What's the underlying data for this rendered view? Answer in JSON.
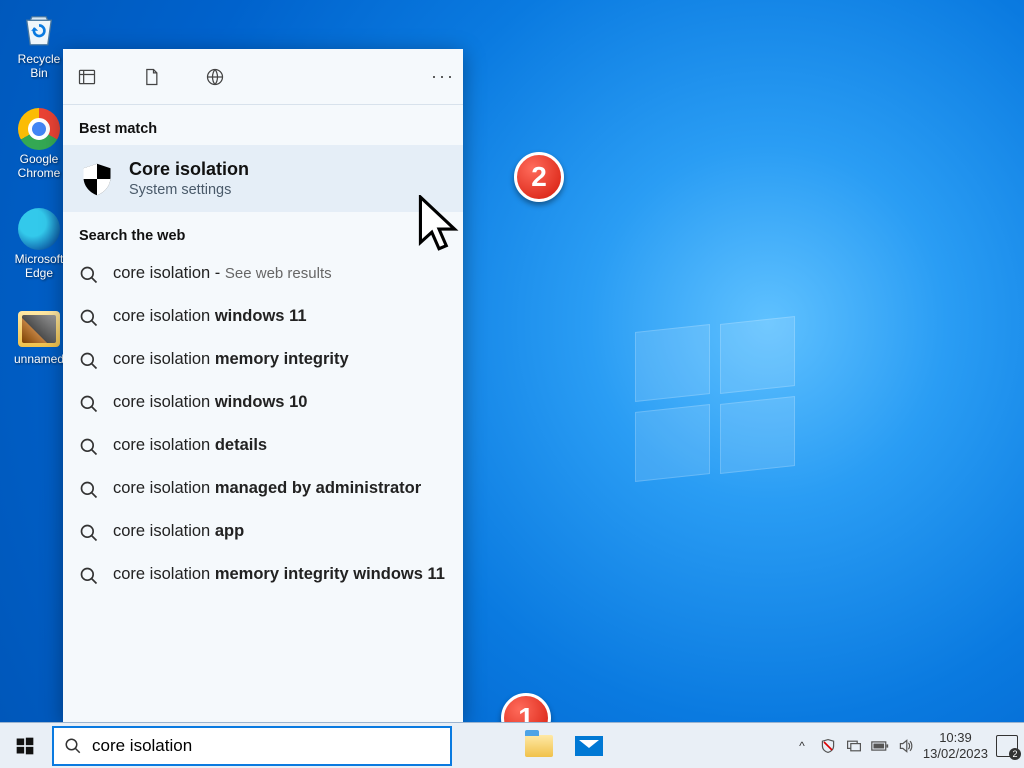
{
  "desktop_icons": [
    {
      "label": "Recycle Bin",
      "kind": "recycle"
    },
    {
      "label": "Google Chrome",
      "kind": "chrome"
    },
    {
      "label": "Microsoft Edge",
      "kind": "edge"
    },
    {
      "label": "unnamed",
      "kind": "folder"
    }
  ],
  "search_panel": {
    "section_best_match": "Best match",
    "best_match": {
      "title": "Core isolation",
      "subtitle": "System settings"
    },
    "section_web": "Search the web",
    "web_results": [
      {
        "prefix": "core isolation",
        "bold": "",
        "suffix": " - ",
        "trail": "See web results"
      },
      {
        "prefix": "core isolation ",
        "bold": "windows 11",
        "suffix": "",
        "trail": ""
      },
      {
        "prefix": "core isolation ",
        "bold": "memory integrity",
        "suffix": "",
        "trail": ""
      },
      {
        "prefix": "core isolation ",
        "bold": "windows 10",
        "suffix": "",
        "trail": ""
      },
      {
        "prefix": "core isolation ",
        "bold": "details",
        "suffix": "",
        "trail": ""
      },
      {
        "prefix": "core isolation ",
        "bold": "managed by administrator",
        "suffix": "",
        "trail": ""
      },
      {
        "prefix": "core isolation ",
        "bold": "app",
        "suffix": "",
        "trail": ""
      },
      {
        "prefix": "core isolation ",
        "bold": "memory integrity windows 11",
        "suffix": "",
        "trail": ""
      }
    ]
  },
  "search_box": {
    "value": "core isolation"
  },
  "tray": {
    "time": "10:39",
    "date": "13/02/2023",
    "notif_count": "2",
    "chevron": "^"
  },
  "annotations": {
    "badge1": "1",
    "badge2": "2"
  }
}
